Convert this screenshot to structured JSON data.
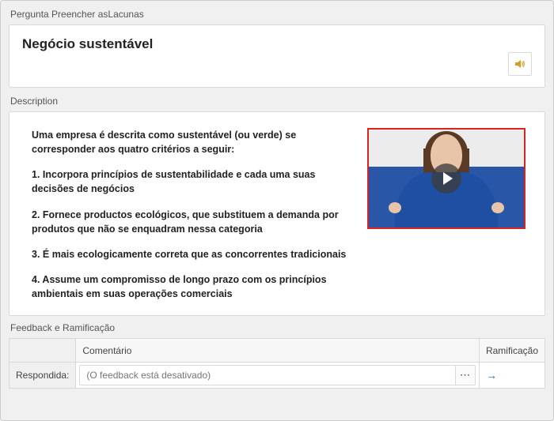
{
  "header": {
    "label": "Pergunta Preencher asLacunas"
  },
  "title_card": {
    "title": "Negócio sustentável"
  },
  "description": {
    "label": "Description",
    "paragraphs": {
      "p0": "Uma empresa é descrita como sustentável (ou verde) se corresponder aos quatro critérios a seguir:",
      "p1": "1. Incorpora princípios de sustentabilidade e cada uma suas decisões de negócios",
      "p2": "2. Fornece productos ecológicos, que substituem a demanda por produtos que não se enquadram nessa categoria",
      "p3": "3. É mais ecologicamente correta que as concorrentes tradicionais",
      "p4": "4. Assume um compromisso de longo prazo com os princípios ambientais em suas operações comerciais"
    }
  },
  "feedback": {
    "label": "Feedback e Ramificação",
    "columns": {
      "comment": "Comentário",
      "ramification": "Ramificação"
    },
    "row_label": "Respondida:",
    "placeholder": "(O feedback está desativado)",
    "more_label": "⋯",
    "ram_arrow": "→"
  }
}
